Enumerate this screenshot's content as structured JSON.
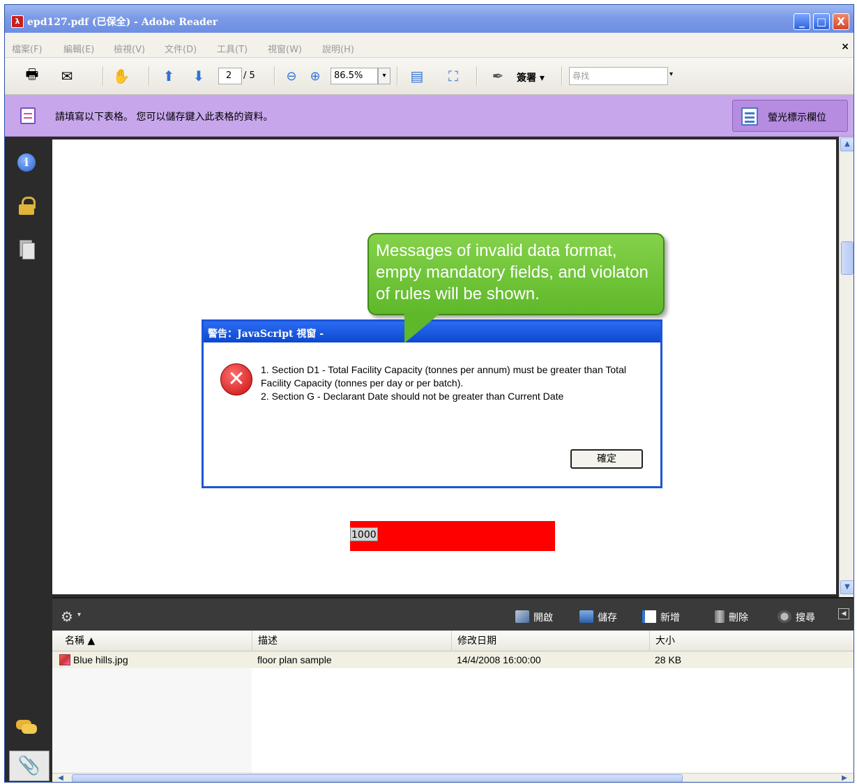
{
  "window": {
    "title": "epd127.pdf (已保全) - Adobe Reader",
    "minimize": "_",
    "maximize": "□",
    "close": "X"
  },
  "menu": {
    "items": [
      "檔案(F)",
      "編輯(E)",
      "檢視(V)",
      "文件(D)",
      "工具(T)",
      "視窗(W)",
      "說明(H)"
    ],
    "close": "×"
  },
  "toolbar": {
    "page_current": "2",
    "page_total": "/ 5",
    "zoom": "86.5%",
    "sign_label": "簽署 ▾",
    "search_placeholder": "尋找"
  },
  "formbar": {
    "message": "請填寫以下表格。 您可以儲存鍵入此表格的資料。",
    "highlight_label": "螢光標示欄位"
  },
  "callout": {
    "text": "Messages of invalid data format, empty mandatory fields, and violaton of rules will be shown."
  },
  "dialog": {
    "title": "警告：JavaScript 視窗 -",
    "lines": [
      "1.   Section D1 - Total Facility Capacity (tonnes per annum) must be greater than Total Facility Capacity (tonnes per day or per batch).",
      "2.   Section G - Declarant Date should not be greater than Current Date"
    ],
    "ok_label": "確定"
  },
  "field": {
    "value": "1000",
    "highlight_color": "#ff0000"
  },
  "attachments": {
    "buttons": {
      "open": "開啟",
      "save": "儲存",
      "add": "新增",
      "delete": "刪除",
      "search": "搜尋"
    },
    "columns": [
      "名稱 ▲",
      "描述",
      "修改日期",
      "大小"
    ],
    "rows": [
      {
        "name": "Blue hills.jpg",
        "description": "floor plan sample",
        "modified": "14/4/2008 16:00:00",
        "size": "28 KB"
      }
    ]
  },
  "colors": {
    "title_blue": "#1d55d8",
    "formbar_purple": "#c8a6ec",
    "callout_green": "#5fb82a",
    "nav_dark": "#2b2b2b"
  }
}
